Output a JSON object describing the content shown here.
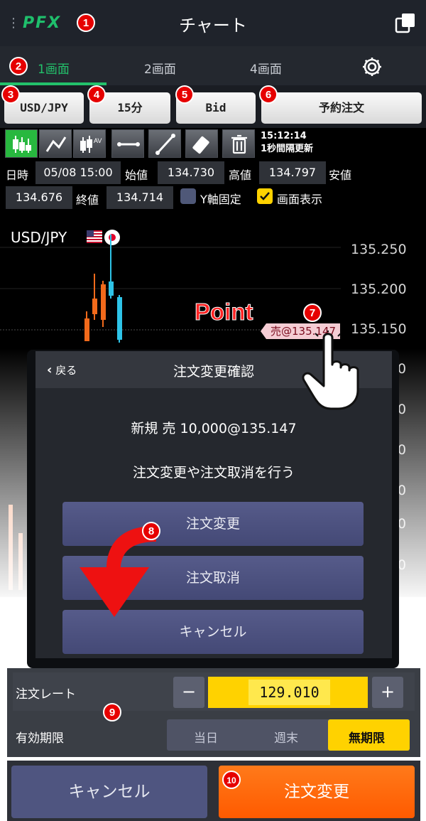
{
  "header": {
    "logo": "PFX",
    "menu_dots": "⋮",
    "title": "チャート",
    "share_icon": "share-icon"
  },
  "tabs": [
    {
      "label": "1画面",
      "active": true
    },
    {
      "label": "2画面"
    },
    {
      "label": "4画面"
    }
  ],
  "toolbar": {
    "pair": "USD/JPY",
    "interval": "15分",
    "side": "Bid",
    "reserve": "予約注文"
  },
  "chart_tools": [
    "candlestick-icon",
    "line-chart-icon",
    "indicator-icon",
    "horizontal-line-icon",
    "trend-line-icon",
    "eraser-icon",
    "trash-icon"
  ],
  "update": {
    "time": "15:12:14",
    "interval_text": "1秒間隔更新"
  },
  "ohlc": {
    "date_label": "日時",
    "date": "05/08 15:00",
    "open_label": "始値",
    "open": "134.730",
    "high_label": "高値",
    "high": "134.797",
    "low_label": "安値",
    "low": "134.676",
    "close_label": "終値",
    "close": "134.714",
    "yfix_label": "Y軸固定",
    "yfix_checked": false,
    "display_label": "画面表示",
    "display_checked": true
  },
  "chart": {
    "pair": "USD/JPY",
    "y_ticks": [
      "135.250",
      "135.200",
      "135.150"
    ],
    "hidden_ticks": [
      "0",
      "0",
      "0",
      "0",
      "0",
      "0"
    ],
    "sell_tag": "売@135.147",
    "point_label": "Point"
  },
  "dialog": {
    "back": "戻る",
    "title": "注文変更確認",
    "order": "新規 売 10,000@135.147",
    "message": "注文変更や注文取消を行う",
    "buttons": [
      "注文変更",
      "注文取消",
      "キャンセル"
    ]
  },
  "order_form": {
    "rate_label": "注文レート",
    "minus": "−",
    "rate": "129.010",
    "plus": "+",
    "validity_label": "有効期限",
    "validity_options": [
      "当日",
      "週末",
      "無期限"
    ],
    "validity_selected": "無期限"
  },
  "footer": {
    "cancel": "キャンセル",
    "confirm": "注文変更"
  },
  "markers": [
    "1",
    "2",
    "3",
    "4",
    "5",
    "6",
    "7",
    "8",
    "9",
    "10"
  ],
  "colors": {
    "accent_green": "#23c16b",
    "bull": "#2ec4e8",
    "bear": "#f26a1b",
    "primary_orange": "#ff6a00",
    "rate_yellow": "#ffd200"
  }
}
